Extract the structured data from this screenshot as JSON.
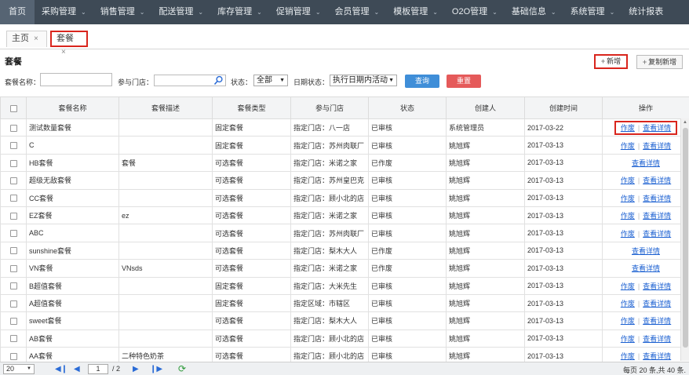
{
  "nav": {
    "home": "首页",
    "items": [
      "采购管理",
      "销售管理",
      "配送管理",
      "库存管理",
      "促销管理",
      "会员管理",
      "模板管理",
      "O2O管理",
      "基础信息",
      "系统管理",
      "统计报表"
    ]
  },
  "tabs": {
    "home": "主页",
    "current": "套餐",
    "close_glyph": "×"
  },
  "page": {
    "title": "套餐",
    "add_label": "新增",
    "copy_add_label": "复制新增"
  },
  "filters": {
    "name_label": "套餐名称：",
    "store_label": "参与门店：",
    "status_label": "状态：",
    "status_value": "全部",
    "date_status_label": "日期状态：",
    "date_status_value": "执行日期内活动",
    "query_label": "查询",
    "reset_label": "重置"
  },
  "table": {
    "columns": [
      "套餐名称",
      "套餐描述",
      "套餐类型",
      "参与门店",
      "状态",
      "创建人",
      "创建时间",
      "操作"
    ],
    "op_void": "作废",
    "op_detail": "查看详情",
    "rows": [
      {
        "name": "测试数量套餐",
        "desc": "",
        "type": "固定套餐",
        "store": "指定门店：八一店",
        "status": "已审核",
        "creator": "系统管理员",
        "date": "2017-03-22",
        "ops": "both"
      },
      {
        "name": "C",
        "desc": "",
        "type": "固定套餐",
        "store": "指定门店：苏州肉联厂",
        "status": "已审核",
        "creator": "姚旭辉",
        "date": "2017-03-13",
        "ops": "both"
      },
      {
        "name": "HB套餐",
        "desc": "套餐",
        "type": "可选套餐",
        "store": "指定门店：米诺之家",
        "status": "已作废",
        "creator": "姚旭辉",
        "date": "2017-03-13",
        "ops": "detail"
      },
      {
        "name": "超级无敌套餐",
        "desc": "",
        "type": "可选套餐",
        "store": "指定门店：苏州皇巴克",
        "status": "已审核",
        "creator": "姚旭辉",
        "date": "2017-03-13",
        "ops": "both"
      },
      {
        "name": "CC套餐",
        "desc": "",
        "type": "可选套餐",
        "store": "指定门店：顾小北的店",
        "status": "已审核",
        "creator": "姚旭辉",
        "date": "2017-03-13",
        "ops": "both"
      },
      {
        "name": "EZ套餐",
        "desc": "ez",
        "type": "可选套餐",
        "store": "指定门店：米诺之家",
        "status": "已审核",
        "creator": "姚旭辉",
        "date": "2017-03-13",
        "ops": "both"
      },
      {
        "name": "ABC",
        "desc": "",
        "type": "可选套餐",
        "store": "指定门店：苏州肉联厂",
        "status": "已审核",
        "creator": "姚旭辉",
        "date": "2017-03-13",
        "ops": "both"
      },
      {
        "name": "sunshine套餐",
        "desc": "",
        "type": "可选套餐",
        "store": "指定门店：梨木大人",
        "status": "已作废",
        "creator": "姚旭辉",
        "date": "2017-03-13",
        "ops": "detail"
      },
      {
        "name": "VN套餐",
        "desc": "VNsds",
        "type": "可选套餐",
        "store": "指定门店：米诺之家",
        "status": "已作废",
        "creator": "姚旭辉",
        "date": "2017-03-13",
        "ops": "detail"
      },
      {
        "name": "B超值套餐",
        "desc": "",
        "type": "固定套餐",
        "store": "指定门店：大米先生",
        "status": "已审核",
        "creator": "姚旭辉",
        "date": "2017-03-13",
        "ops": "both"
      },
      {
        "name": "A超值套餐",
        "desc": "",
        "type": "固定套餐",
        "store": "指定区域：市辖区",
        "status": "已审核",
        "creator": "姚旭辉",
        "date": "2017-03-13",
        "ops": "both"
      },
      {
        "name": "sweet套餐",
        "desc": "",
        "type": "可选套餐",
        "store": "指定门店：梨木大人",
        "status": "已审核",
        "creator": "姚旭辉",
        "date": "2017-03-13",
        "ops": "both"
      },
      {
        "name": "AB套餐",
        "desc": "",
        "type": "可选套餐",
        "store": "指定门店：顾小北的店",
        "status": "已审核",
        "creator": "姚旭辉",
        "date": "2017-03-13",
        "ops": "both"
      },
      {
        "name": "AA套餐",
        "desc": "二种特色奶茶",
        "type": "可选套餐",
        "store": "指定门店：顾小北的店",
        "status": "已审核",
        "creator": "姚旭辉",
        "date": "2017-03-13",
        "ops": "both"
      }
    ]
  },
  "pager": {
    "page_size": "20",
    "current_page": "1",
    "total_pages": "/ 2",
    "summary": "每页 20 条,共 40 条."
  },
  "colors": {
    "nav_bg": "#3e4a56",
    "highlight_red": "#d9251d",
    "link_blue": "#1a5fd1",
    "query_blue": "#3f8ed8",
    "reset_red": "#e55a5a"
  }
}
